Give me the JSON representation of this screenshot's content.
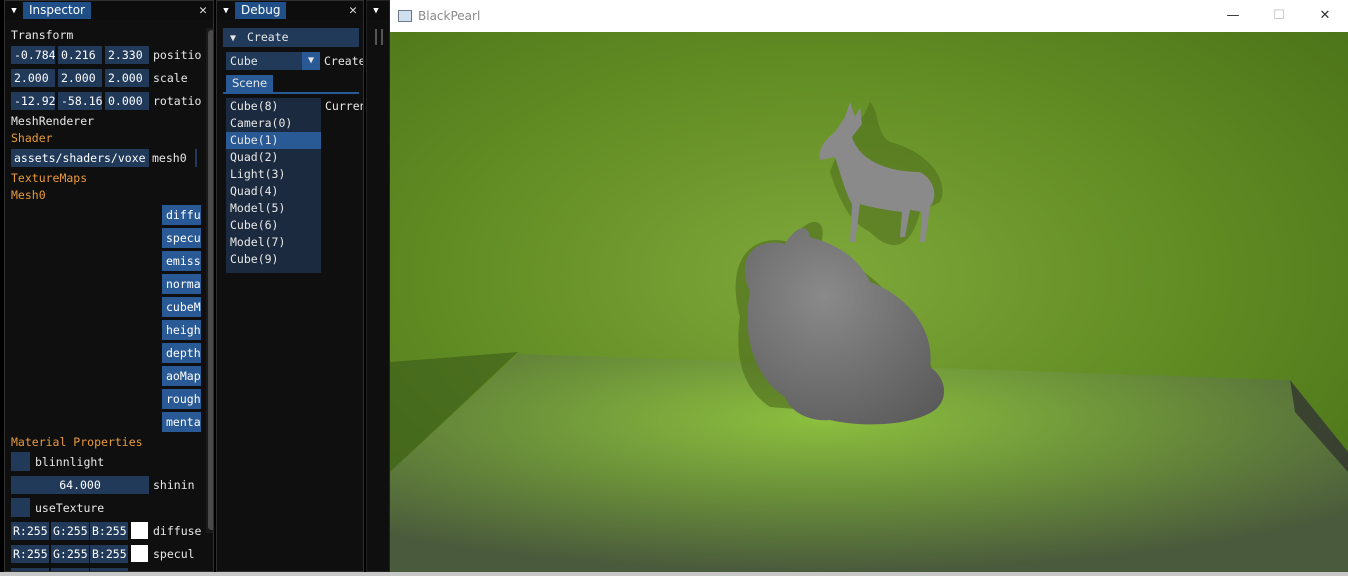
{
  "inspector": {
    "title": "Inspector",
    "close": "✕",
    "transform": {
      "heading": "Transform",
      "position": {
        "x": "-0.784",
        "y": "0.216",
        "z": "2.330",
        "label": "positio"
      },
      "scale": {
        "x": "2.000",
        "y": "2.000",
        "z": "2.000",
        "label": "scale"
      },
      "rotation": {
        "x": "-12.92",
        "y": "-58.16",
        "z": "0.000",
        "label": "rotatio"
      }
    },
    "mesh_renderer": "MeshRenderer",
    "shader_heading": "Shader",
    "shader_path": "assets/shaders/voxe",
    "shader_mesh": "mesh0",
    "texture_maps_heading": "TextureMaps",
    "mesh_heading": "Mesh0",
    "texture_buttons": [
      "diffu",
      "specu",
      "emiss",
      "norma",
      "cubeM",
      "heigh",
      "depth",
      "aoMap",
      "rough",
      "menta"
    ],
    "material_heading": "Material Properties",
    "blinnlight_label": "blinnlight",
    "shininess_value": "64.000",
    "shininess_label": "shinin",
    "use_texture_label": "useTexture",
    "diffuse": {
      "r": "R:255",
      "g": "G:255",
      "b": "B:255",
      "label": "diffuse"
    },
    "specular": {
      "r": "R:255",
      "g": "G:255",
      "b": "B:255",
      "label": "specul"
    }
  },
  "debug": {
    "title": "Debug",
    "close": "✕",
    "create_header": "Create",
    "create_combo_value": "Cube",
    "create_button": "Create",
    "scene_tab": "Scene",
    "scene_items": [
      "Cube(8)",
      "Camera(0)",
      "Cube(1)",
      "Quad(2)",
      "Light(3)",
      "Quad(4)",
      "Model(5)",
      "Cube(6)",
      "Model(7)",
      "Cube(9)"
    ],
    "selected_index": 2,
    "current_label": "Curren"
  },
  "app": {
    "title": "BlackPearl",
    "minimize": "—",
    "maximize": "☐",
    "close": "✕"
  },
  "colors": {
    "panel_bg": "#0f0f0f",
    "title_active": "#1f4f86",
    "field_bg": "#213a5a",
    "button_bg": "#2a5a96",
    "header_orange": "#e89a3c",
    "wall_green": "#6f9a2a",
    "floor_green": "#8cbf3e"
  }
}
